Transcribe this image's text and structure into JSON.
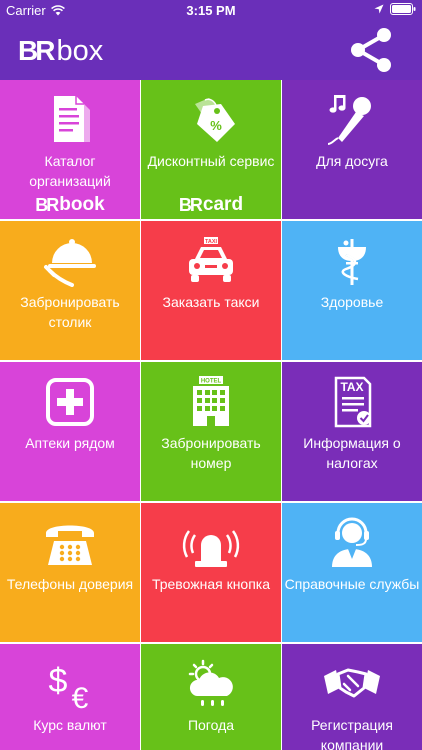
{
  "status_bar": {
    "carrier": "Carrier",
    "time": "3:15 PM"
  },
  "header": {
    "logo_mark": "BR",
    "logo_word": "box"
  },
  "colors": {
    "header": "#6a2fb9",
    "magenta": "#d844d9",
    "green": "#67c119",
    "purple": "#7a2db8",
    "orange": "#f8ac1c",
    "red": "#f63d4a",
    "blue": "#4fb3f5"
  },
  "tiles": [
    {
      "id": "catalog",
      "label": "Каталог организаций",
      "icon": "documents-icon",
      "sublogo_mark": "BR",
      "sublogo_word": "book",
      "color": "#d844d9"
    },
    {
      "id": "discount",
      "label": "Дисконтный сервис",
      "icon": "discount-tags-icon",
      "sublogo_mark": "BR",
      "sublogo_word": "card",
      "color": "#67c119"
    },
    {
      "id": "leisure",
      "label": "Для досуга",
      "icon": "microphone-music-icon",
      "color": "#7a2db8"
    },
    {
      "id": "table",
      "label": "Забронировать столик",
      "icon": "waiter-cloche-icon",
      "color": "#f8ac1c"
    },
    {
      "id": "taxi",
      "label": "Заказать такси",
      "icon": "taxi-icon",
      "taxi_sign": "TAXI",
      "color": "#f63d4a"
    },
    {
      "id": "health",
      "label": "Здоровье",
      "icon": "caduceus-icon",
      "color": "#4fb3f5"
    },
    {
      "id": "pharmacy",
      "label": "Аптеки рядом",
      "icon": "pharmacy-cross-icon",
      "color": "#d844d9"
    },
    {
      "id": "hotel",
      "label": "Забронировать номер",
      "icon": "hotel-icon",
      "hotel_sign": "HOTEL",
      "color": "#67c119"
    },
    {
      "id": "taxes",
      "label": "Информация о налогах",
      "icon": "tax-document-icon",
      "tax_sign": "TAX",
      "color": "#7a2db8"
    },
    {
      "id": "hotline",
      "label": "Телефоны доверия",
      "icon": "telephone-icon",
      "color": "#f8ac1c"
    },
    {
      "id": "alarm",
      "label": "Тревожная кнопка",
      "icon": "alarm-siren-icon",
      "color": "#f63d4a"
    },
    {
      "id": "info",
      "label": "Справочные службы",
      "icon": "support-operator-icon",
      "color": "#4fb3f5"
    },
    {
      "id": "currency",
      "label": "Курс валют",
      "icon": "currency-icon",
      "color": "#d844d9"
    },
    {
      "id": "weather",
      "label": "Погода",
      "icon": "weather-icon",
      "color": "#67c119"
    },
    {
      "id": "registration",
      "label": "Регистрация компании",
      "icon": "handshake-icon",
      "color": "#7a2db8"
    }
  ]
}
